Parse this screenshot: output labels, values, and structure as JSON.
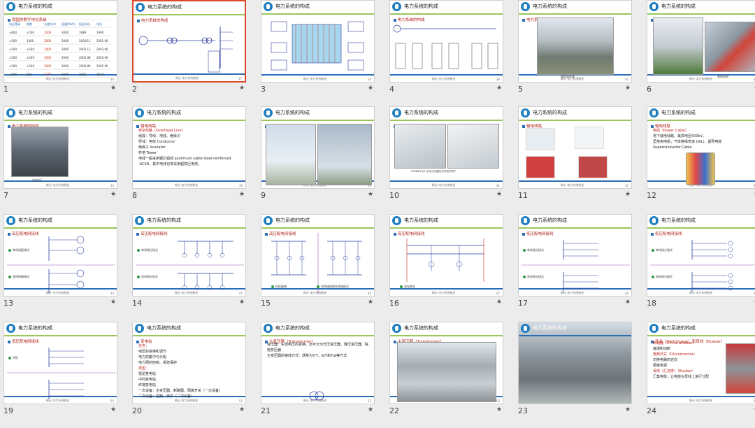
{
  "common": {
    "header_title": "电力系统的构成",
    "footer_text": "概论 电力系统概述",
    "star": "★"
  },
  "slides": [
    {
      "num": "1",
      "sub": "我国的数字电化系统",
      "page": "36",
      "table": [
        [
          "电压等级",
          "根数",
          "长度(km)",
          "容量(MVA)",
          "投运年份",
          "年份"
        ],
        [
          "±800",
          "±500",
          "1200",
          "3000",
          "1989",
          "1990"
        ],
        [
          "±500",
          "1000",
          "2000",
          "3000",
          "2000/11",
          "2001.06"
        ],
        [
          "±500",
          "±500",
          "1000",
          "3000",
          "2002.11",
          "2003.06"
        ],
        [
          "±500",
          "±500",
          "1000",
          "3000",
          "2003.08",
          "2004.06"
        ],
        [
          "±500",
          "±500",
          "1000",
          "3000",
          "2004.06",
          "2005.06"
        ],
        [
          "±500",
          "950",
          "1375",
          "3000",
          "2006",
          "2010"
        ]
      ]
    },
    {
      "num": "2",
      "sub": "电力系统的构成",
      "page": "37"
    },
    {
      "num": "3",
      "sub": "",
      "page": "38"
    },
    {
      "num": "4",
      "sub": "电力系统的构成",
      "page": "39"
    },
    {
      "num": "5",
      "sub": "电力系统的构成",
      "page": "40",
      "caption": "变电站外景"
    },
    {
      "num": "6",
      "sub": "电力系统的构成",
      "page": "41",
      "caption": "查线巡线"
    },
    {
      "num": "7",
      "sub": "电力系统的构成",
      "page": "35",
      "caption": "发电机厂"
    },
    {
      "num": "8",
      "sub": "输电线路",
      "page": "39",
      "lines": [
        "架空线路（Overhead Line）",
        "组成：导线、地线、绝缘子",
        "导线：电线    Conductor",
        "绝缘子    Insulator",
        "杆塔    Tower",
        "电线一般采用钢芯铝线 aluminum cable steel reinforced",
        "-ACSR。其中电线也常采用超高压电线。"
      ]
    },
    {
      "num": "9",
      "sub": "输电线路",
      "page": "40"
    },
    {
      "num": "10",
      "sub": "输电线路",
      "page": "41",
      "caption": "2008年1月27日电力线路在冰冻的环境下"
    },
    {
      "num": "11",
      "sub": "输电线路",
      "page": "42"
    },
    {
      "num": "12",
      "sub": "输电线路",
      "page": "43",
      "lines": [
        "电缆（Power Cable）",
        "地下输电线路，最高电压500kV。",
        "里常用电缆，气体绝缘管道 (GIL)，超导电缆",
        "Superconductor Cable"
      ]
    },
    {
      "num": "13",
      "sub": "高压配电网接线",
      "page": "44",
      "lines": [
        "单母线接线式",
        "双母线接线式"
      ]
    },
    {
      "num": "14",
      "sub": "高压配电网接线",
      "page": "45",
      "lines": [
        "单母线分段式",
        "双母线分段式"
      ]
    },
    {
      "num": "15",
      "sub": "高压配电网接线",
      "page": "46",
      "lines": [
        "桥形接线",
        "内桥接线和外桥接线式"
      ]
    },
    {
      "num": "16",
      "sub": "高压配电网接线",
      "page": "47",
      "lines": [
        "双母线式"
      ]
    },
    {
      "num": "17",
      "sub": "低压配电网接线",
      "page": "48",
      "lines": [
        "单母线分段式",
        "双母线分段式"
      ]
    },
    {
      "num": "18",
      "sub": "低压配电网接线",
      "page": "49",
      "lines": [
        "单母线分段式",
        "双母线分段式"
      ]
    },
    {
      "num": "19",
      "sub": "低压配电网接线",
      "page": "50",
      "lines": [
        "环形"
      ]
    },
    {
      "num": "20",
      "sub": "变电站",
      "page": "51",
      "lines": [
        "任务：",
        "电压的变换和调节",
        "电力的集中与分配",
        "电力网的控制、系统保护",
        "类型：",
        "枢纽变电站",
        "中间变电站",
        "终端变电站",
        "一次设备：主变压器、断路器、隔离开关（一次设备）",
        "二次设备：控制、保护（二次设备）"
      ]
    },
    {
      "num": "21",
      "sub": "主变压器（Transformer）",
      "page": "52",
      "lines": [
        "变压器：实现电压的变换，还可分为升压变压器、降压变压器、联络变压器",
        "主变压器的接线方式：通常为Y/Y、Δ/Y和Y/Δ等方式"
      ]
    },
    {
      "num": "22",
      "sub": "主变压器（Transformer）",
      "page": "53"
    },
    {
      "num": "23",
      "sub": "",
      "page": "54"
    },
    {
      "num": "24",
      "sub": "开关（Switchgear）和母线（Busbar）",
      "page": "55",
      "lines": [
        "断路器（Circuit breaker）",
        "接通和切断",
        "隔离开关（Disconnector）",
        "切换电路的定向",
        "隔离电源",
        "母线（汇流排）（Busbar）",
        "汇集电能，让电能在母线上进行分配"
      ]
    }
  ]
}
